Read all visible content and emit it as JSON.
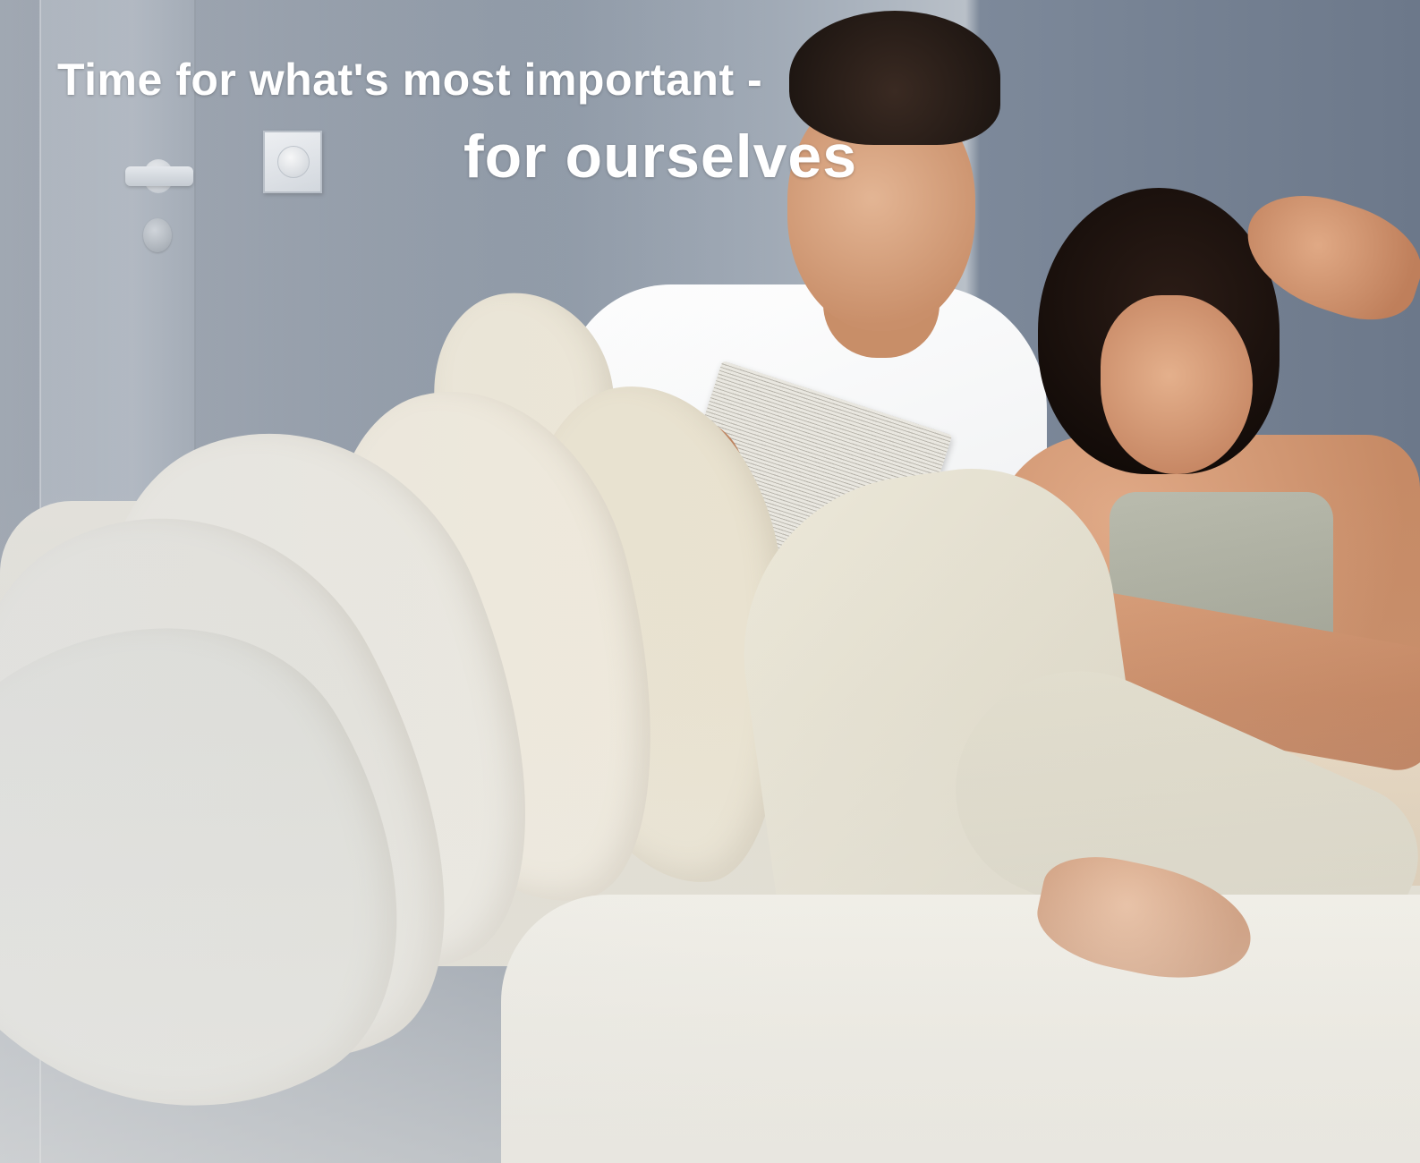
{
  "headline": {
    "line1": "Time for what's most important -",
    "line2": "for ourselves"
  },
  "colors": {
    "text": "#ffffff",
    "wall": "#7e8998",
    "sofa": "#ebe8df"
  },
  "icons": {
    "switch": "light-switch-icon",
    "handle": "door-handle-icon",
    "lock": "door-lock-icon"
  }
}
